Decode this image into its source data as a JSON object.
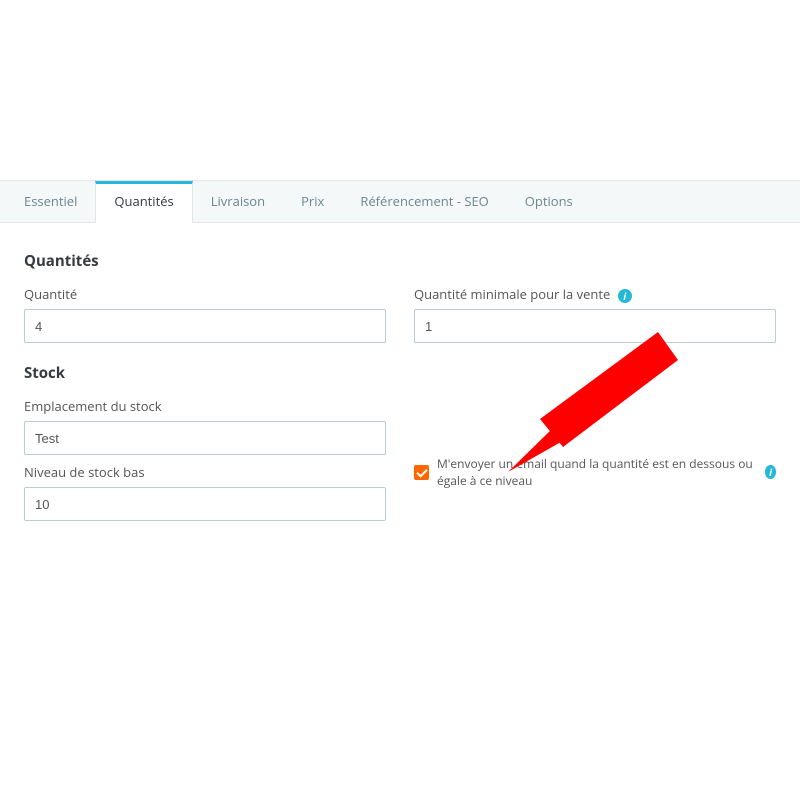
{
  "tabs": {
    "essentiel": "Essentiel",
    "quantites": "Quantités",
    "livraison": "Livraison",
    "prix": "Prix",
    "seo": "Référencement - SEO",
    "options": "Options"
  },
  "sections": {
    "quantites_heading": "Quantités",
    "stock_heading": "Stock"
  },
  "fields": {
    "quantite": {
      "label": "Quantité",
      "value": "4"
    },
    "qte_min": {
      "label": "Quantité minimale pour la vente",
      "value": "1"
    },
    "emplacement": {
      "label": "Emplacement du stock",
      "value": "Test"
    },
    "niveau_bas": {
      "label": "Niveau de stock bas",
      "value": "10"
    },
    "email_alert": {
      "label": "M'envoyer un email quand la quantité est en dessous ou égale à ce niveau",
      "checked": true
    }
  },
  "icons": {
    "info": "i"
  }
}
